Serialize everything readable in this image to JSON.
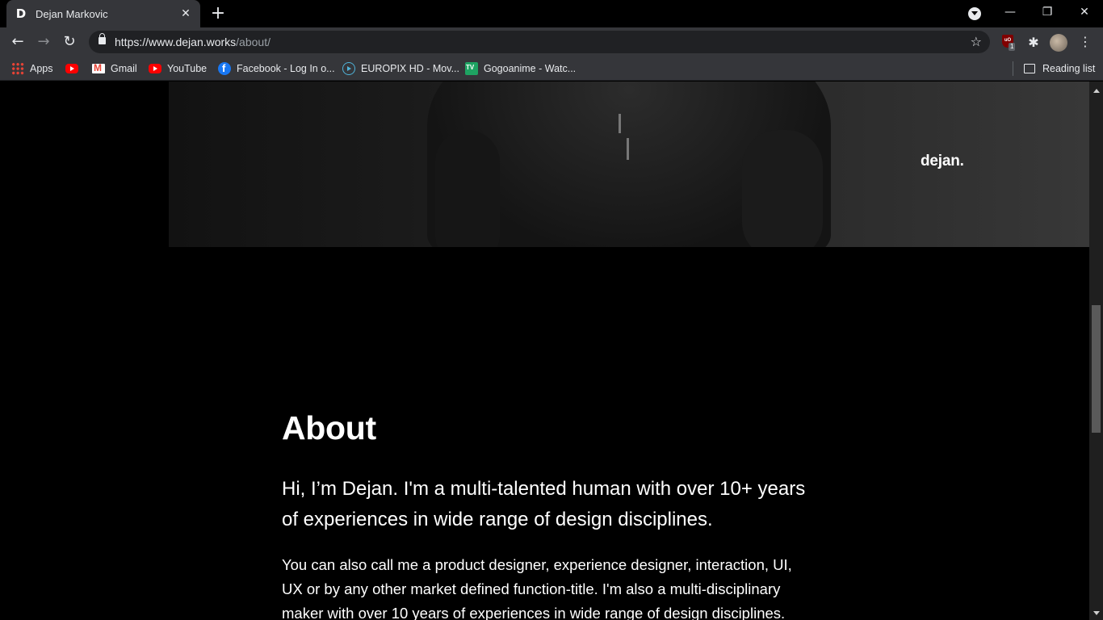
{
  "browser": {
    "tab": {
      "favicon": "D",
      "title": "Dejan Markovic",
      "close_icon": "✕"
    },
    "new_tab_icon": "+",
    "window": {
      "minimize": "—",
      "restore": "❐",
      "close": "✕"
    },
    "nav": {
      "back": "←",
      "forward": "→",
      "reload": "↻"
    },
    "url": {
      "host": "https://www.dejan.works",
      "path": "/about/"
    },
    "star_icon": "☆",
    "extensions": {
      "ublock_label": "uO",
      "ublock_count": "1",
      "puzzle_icon": "✱"
    },
    "menu_icon": "⋮",
    "bookmarks": [
      {
        "label": "Apps",
        "icon": "apps-grid-icon"
      },
      {
        "label": "",
        "icon": "youtube-icon"
      },
      {
        "label": "Gmail",
        "icon": "gmail-icon"
      },
      {
        "label": "YouTube",
        "icon": "youtube-icon"
      },
      {
        "label": "Facebook - Log In o...",
        "icon": "facebook-icon"
      },
      {
        "label": "EUROPIX HD - Mov...",
        "icon": "europix-icon"
      },
      {
        "label": "Gogoanime - Watc...",
        "icon": "gogoanime-icon"
      }
    ],
    "reading_list": "Reading list"
  },
  "page": {
    "hero_logo": "dejan.",
    "about": {
      "title": "About",
      "lead": "Hi, I’m Dejan. I'm a multi-talented human with over 10+ years of experiences in wide range of design disciplines.",
      "body": "You can also call me a product designer, experience designer, interaction, UI, UX or by any other market defined function-title. I'm also a multi-disciplinary maker with over 10 years of experiences in wide range of design disciplines."
    }
  },
  "colors": {
    "page_bg": "#000000",
    "chrome_bg": "#35363a",
    "omnibox_bg": "#202124"
  }
}
